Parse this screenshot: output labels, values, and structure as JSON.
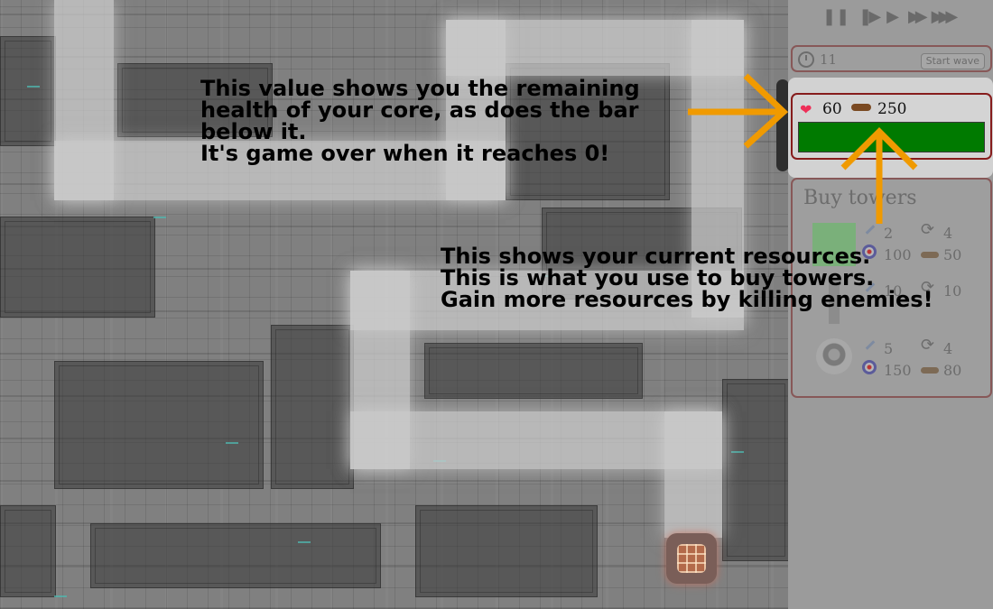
{
  "controls": {
    "pause_icon": "pause-icon",
    "step_icon": "step-icon",
    "play_icon": "play-icon",
    "fast_icon": "fast-forward-icon",
    "faster_icon": "fastest-forward-icon"
  },
  "wave": {
    "icon": "clock-icon",
    "timer": "11",
    "start_label": "Start wave"
  },
  "status": {
    "health_icon": "heart-icon",
    "health": "60",
    "resources_icon": "resources-icon",
    "resources": "250",
    "health_bar_color": "#007a00"
  },
  "shop": {
    "title": "Buy towers",
    "towers": [
      {
        "name": "green-tower",
        "damage": "2",
        "reload": "4",
        "range": "100",
        "cost": "50"
      },
      {
        "name": "pillar-tower",
        "damage": "10",
        "reload": "10",
        "range": "",
        "cost": ""
      },
      {
        "name": "orb-tower",
        "damage": "5",
        "reload": "4",
        "range": "150",
        "cost": "80"
      }
    ]
  },
  "notes": {
    "health": "This value shows you the remaining\nhealth of your core, as does the bar\nbelow it.\nIt's game over when it reaches 0!",
    "resources": "This shows your current resources.\nThis is what you use to buy towers.\nGain more resources by killing enemies!"
  },
  "colors": {
    "arrow": "#f09a00",
    "panel_border": "#875858",
    "status_border": "#861c1c",
    "heart": "#ee2f58"
  }
}
